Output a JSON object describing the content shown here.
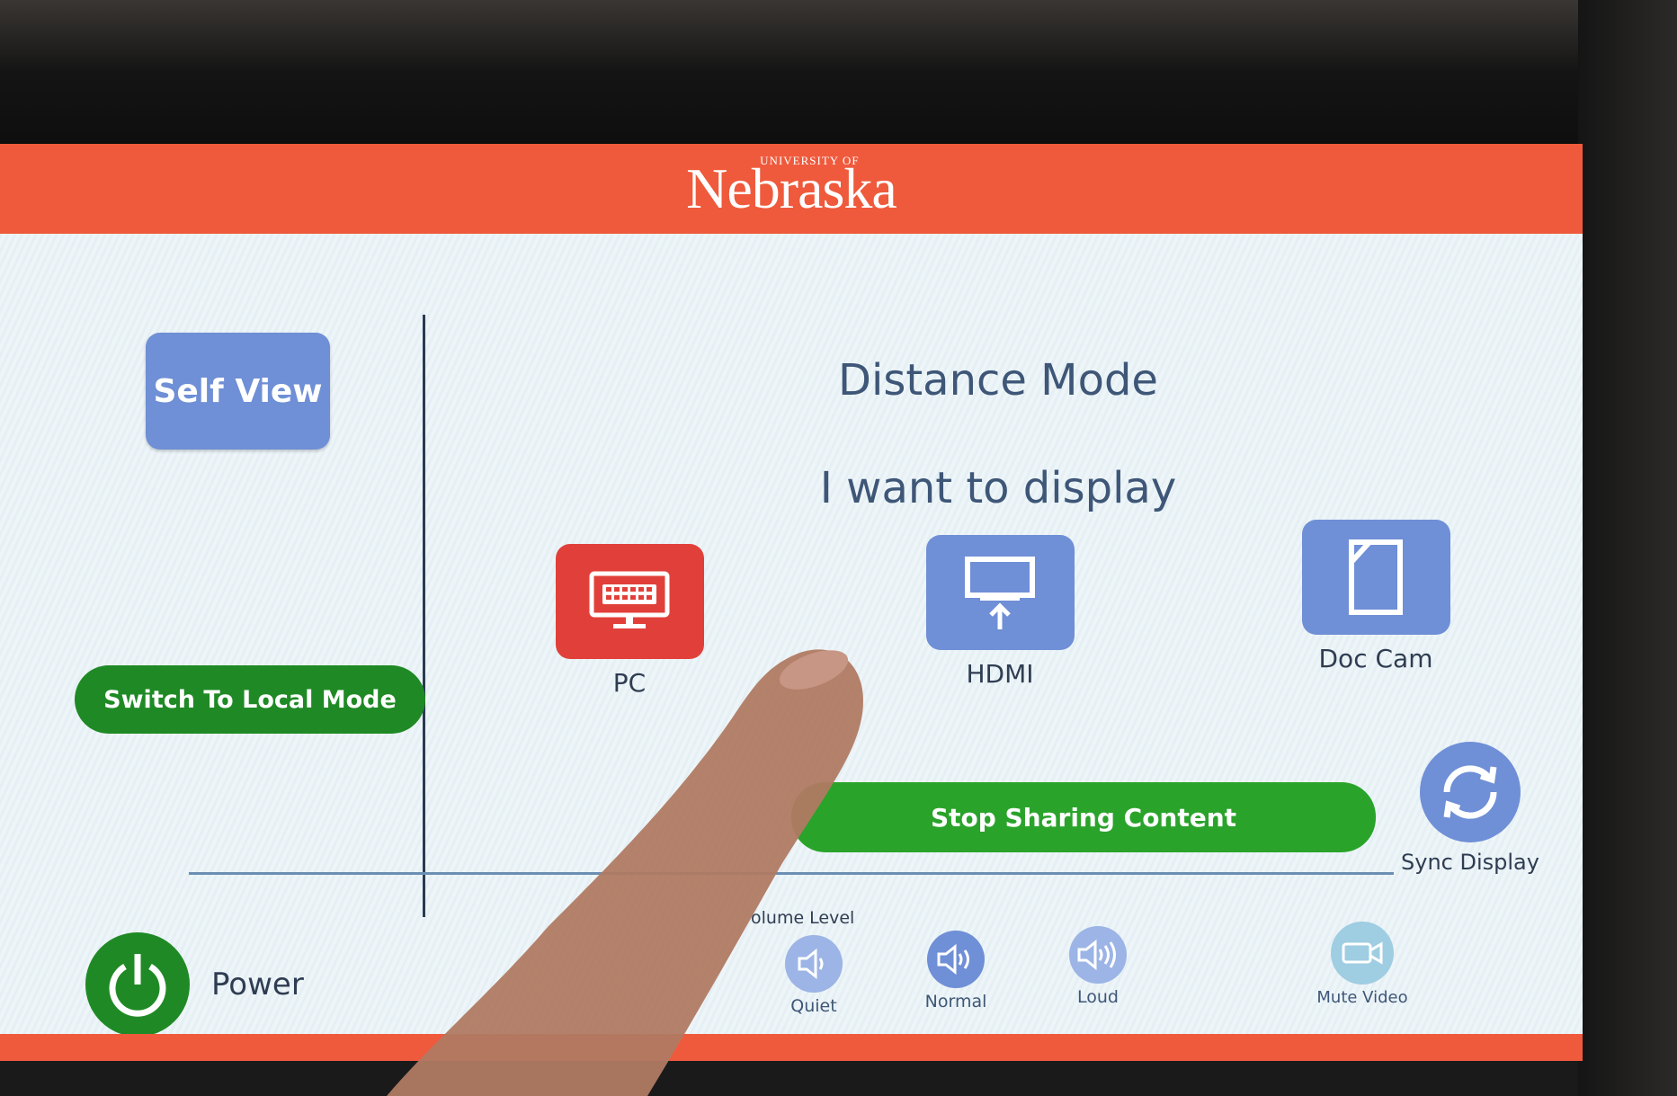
{
  "header": {
    "brand": "Nebraska",
    "brand_small": "UNIVERSITY OF"
  },
  "left_panel": {
    "self_view_label": "Self View",
    "switch_mode_label": "Switch To Local Mode"
  },
  "main": {
    "title": "Distance Mode",
    "subtitle": "I want to display",
    "sources": [
      {
        "label": "PC",
        "icon": "keyboard-monitor-icon"
      },
      {
        "label": "HDMI",
        "icon": "display-input-icon"
      },
      {
        "label": "Doc Cam",
        "icon": "document-camera-icon"
      }
    ],
    "stop_sharing_label": "Stop Sharing Content",
    "sync_display_label": "Sync Display"
  },
  "footer": {
    "power_label": "Power",
    "volume_title": "olume Level",
    "volume_levels": [
      {
        "label": "Quiet",
        "icon": "speaker-quiet-icon"
      },
      {
        "label": "Normal",
        "icon": "speaker-normal-icon"
      },
      {
        "label": "Loud",
        "icon": "speaker-loud-icon"
      }
    ],
    "mute_video_label": "Mute Video"
  },
  "colors": {
    "brand_red": "#ef5a3c",
    "source_active": "#e1403a",
    "button_blue": "#6f8fd6",
    "button_green": "#1f8a25"
  }
}
